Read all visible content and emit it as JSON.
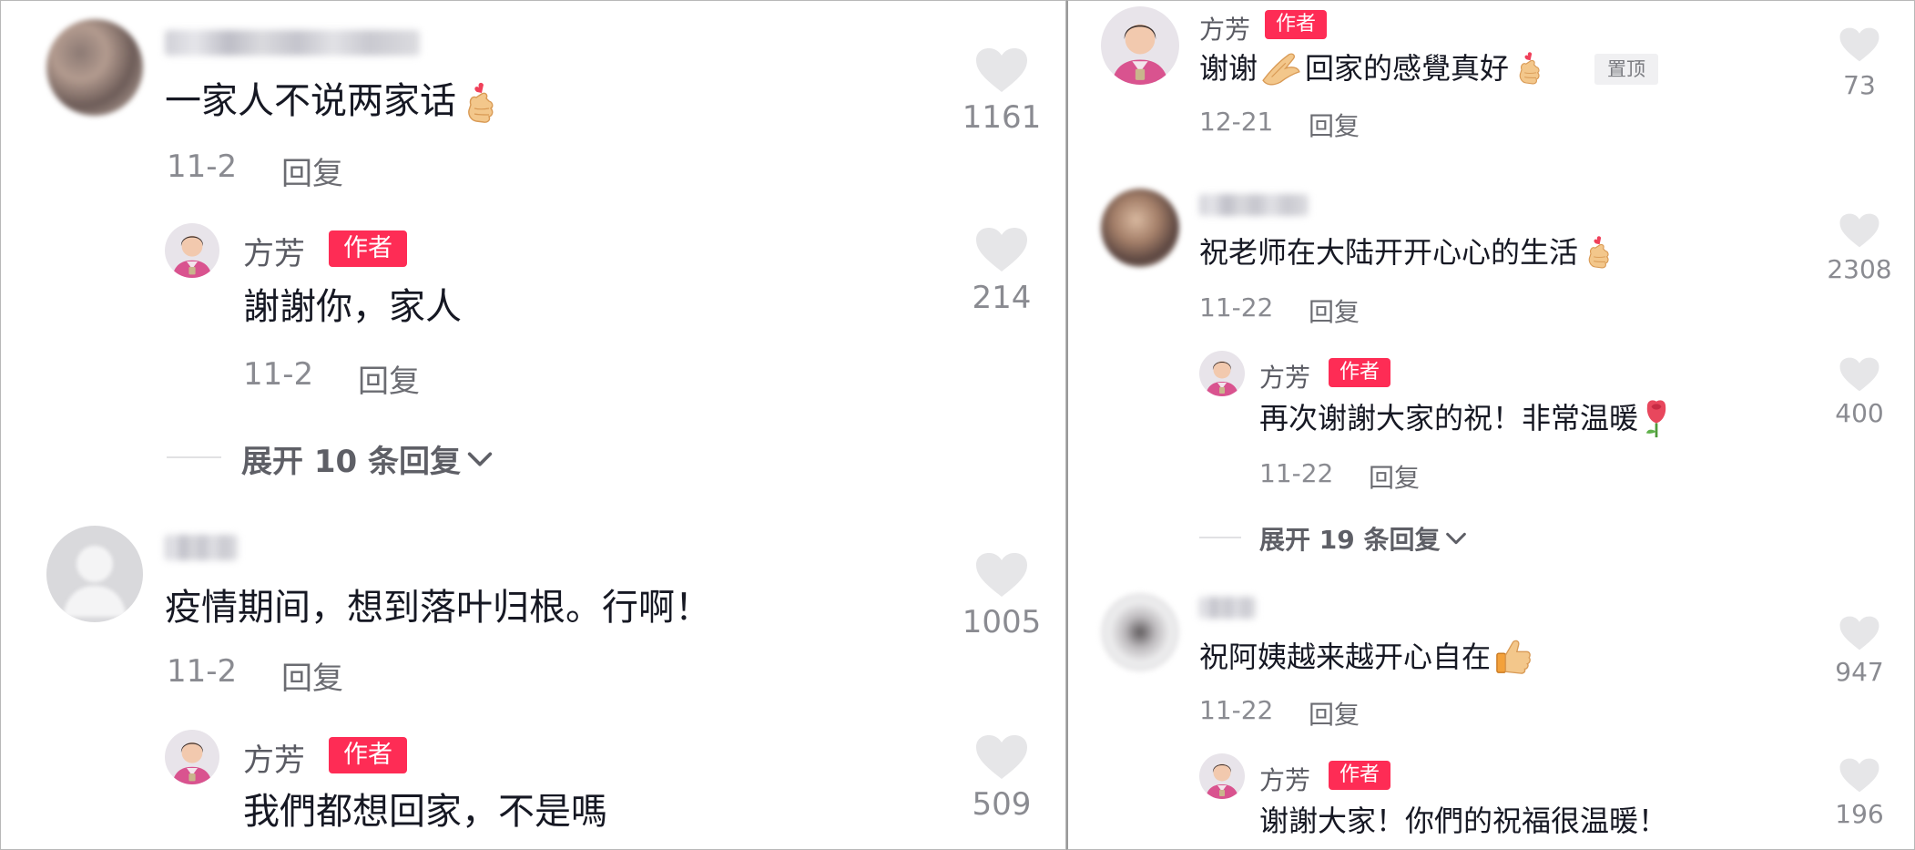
{
  "left": {
    "comments": [
      {
        "text": "一家人不说两家话",
        "date": "11-2",
        "reply_label": "回复",
        "likes": "1161",
        "replies": [
          {
            "author": "方芳",
            "badge": "作者",
            "text": "謝謝你，家人",
            "date": "11-2",
            "reply_label": "回复",
            "likes": "214"
          }
        ],
        "expand": "展开 10 条回复"
      },
      {
        "text": "疫情期间，想到落叶归根。行啊！",
        "date": "11-2",
        "reply_label": "回复",
        "likes": "1005",
        "replies": [
          {
            "author": "方芳",
            "badge": "作者",
            "text": "我們都想回家，不是嗎",
            "likes": "509"
          }
        ]
      }
    ]
  },
  "right": {
    "pinned": {
      "author": "方芳",
      "badge": "作者",
      "text_a": "谢谢",
      "text_b": "回家的感覺真好",
      "pin_label": "置顶",
      "date": "12-21",
      "reply_label": "回复",
      "likes": "73"
    },
    "comments": [
      {
        "text": "祝老师在大陆开开心心的生活",
        "date": "11-22",
        "reply_label": "回复",
        "likes": "2308",
        "replies": [
          {
            "author": "方芳",
            "badge": "作者",
            "text": "再次谢謝大家的祝！非常温暖",
            "date": "11-22",
            "reply_label": "回复",
            "likes": "400"
          }
        ],
        "expand": "展开 19 条回复"
      },
      {
        "text": "祝阿姨越来越开心自在",
        "date": "11-22",
        "reply_label": "回复",
        "likes": "947",
        "replies": [
          {
            "author": "方芳",
            "badge": "作者",
            "text": "谢謝大家！你們的祝福很温暖！",
            "likes": "196"
          }
        ]
      }
    ]
  },
  "colors": {
    "badge": "#fe2c55",
    "heart": "#e6e6e8",
    "text": "#161823",
    "meta": "#8a8b91"
  },
  "icons": [
    "heart-icon",
    "finger-heart-emoji",
    "folded-hands-emoji",
    "rose-emoji",
    "thumbs-up-emoji",
    "chevron-down-icon"
  ]
}
